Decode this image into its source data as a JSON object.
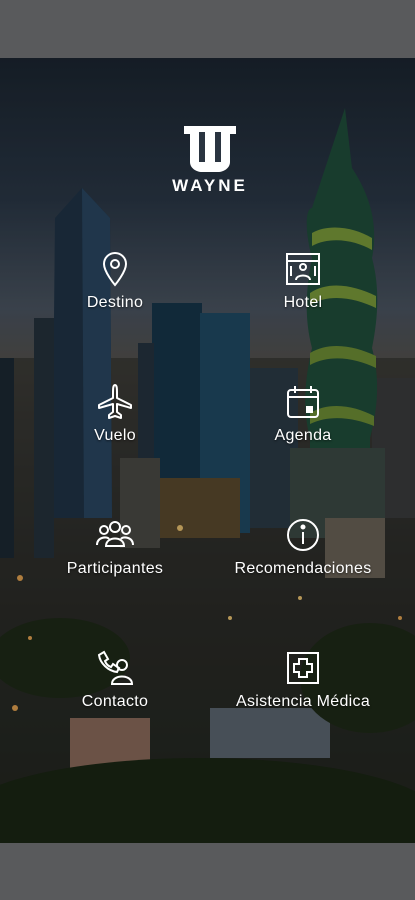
{
  "brand": {
    "name": "WAYNE"
  },
  "menu": [
    {
      "id": "destino",
      "label": "Destino",
      "icon": "map-pin-icon"
    },
    {
      "id": "hotel",
      "label": "Hotel",
      "icon": "hotel-icon"
    },
    {
      "id": "vuelo",
      "label": "Vuelo",
      "icon": "airplane-icon"
    },
    {
      "id": "agenda",
      "label": "Agenda",
      "icon": "calendar-icon"
    },
    {
      "id": "participantes",
      "label": "Participantes",
      "icon": "people-group-icon"
    },
    {
      "id": "recomendaciones",
      "label": "Recomendaciones",
      "icon": "info-icon"
    },
    {
      "id": "contacto",
      "label": "Contacto",
      "icon": "phone-person-icon"
    },
    {
      "id": "asistencia",
      "label": "Asistencia Médica",
      "icon": "medical-cross-icon"
    }
  ],
  "colors": {
    "icon_stroke": "#ffffff",
    "bar": "#595a5c"
  }
}
